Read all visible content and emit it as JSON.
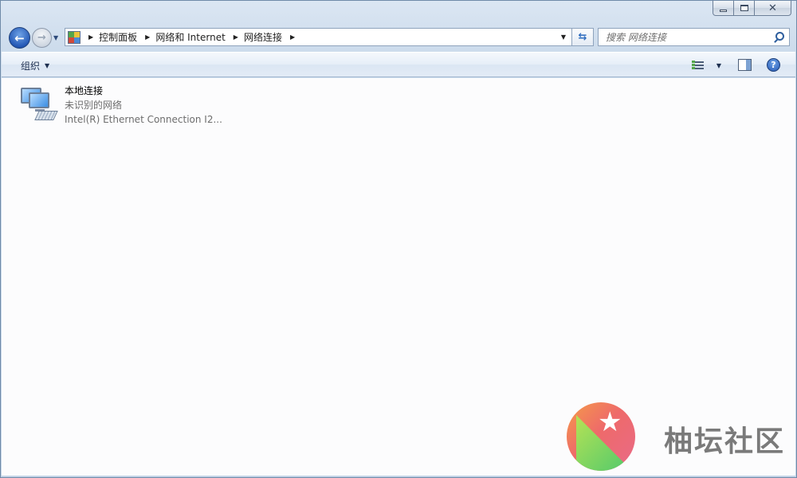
{
  "window": {
    "caption_buttons": [
      "minimize",
      "maximize",
      "close"
    ]
  },
  "navigation": {
    "breadcrumbs": [
      "控制面板",
      "网络和 Internet",
      "网络连接"
    ]
  },
  "search": {
    "placeholder": "搜索 网络连接"
  },
  "command_bar": {
    "organize_label": "组织"
  },
  "items": [
    {
      "name": "本地连接",
      "status": "未识别的网络",
      "device": "Intel(R) Ethernet Connection I2..."
    }
  ],
  "watermark": {
    "text": "柚坛社区"
  },
  "icons": {
    "back": "back-arrow-icon",
    "forward": "forward-arrow-icon",
    "refresh": "refresh-icon",
    "search": "search-icon",
    "views": "change-view-icon",
    "preview_pane": "preview-pane-icon",
    "help": "help-icon"
  }
}
